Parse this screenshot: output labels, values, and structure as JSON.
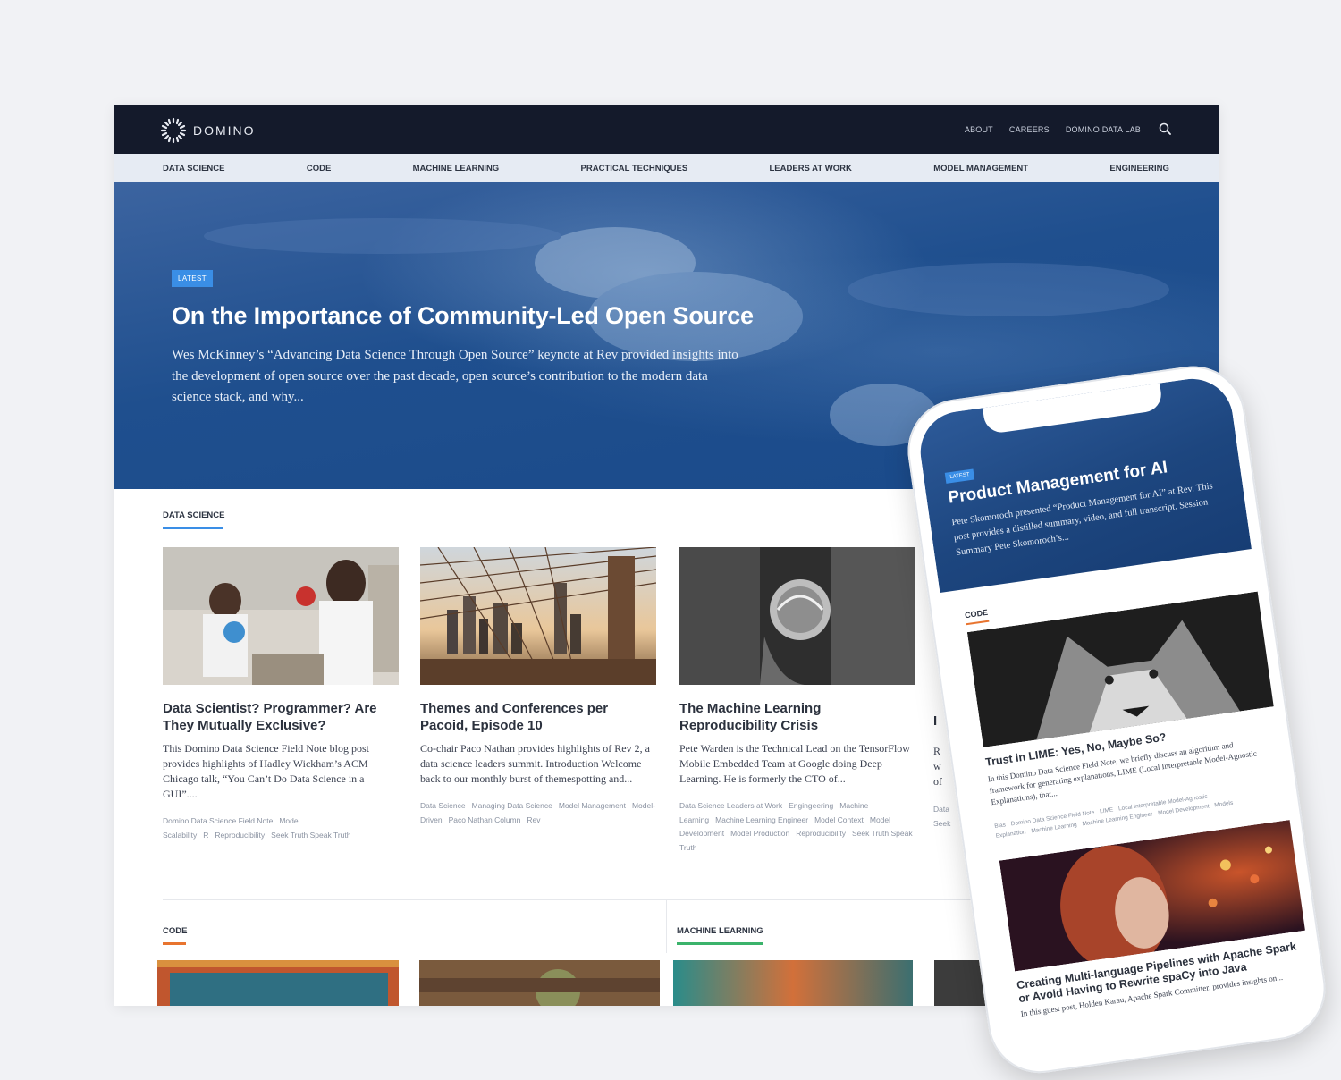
{
  "header": {
    "logo_text": "DOMINO",
    "nav": [
      "ABOUT",
      "CAREERS",
      "DOMINO DATA LAB"
    ]
  },
  "categories": [
    "DATA SCIENCE",
    "CODE",
    "MACHINE LEARNING",
    "PRACTICAL TECHNIQUES",
    "LEADERS AT WORK",
    "MODEL MANAGEMENT",
    "ENGINEERING"
  ],
  "hero": {
    "badge": "LATEST",
    "title": "On the Importance of Community-Led Open Source",
    "description": "Wes McKinney’s “Advancing Data Science Through Open Source” keynote at Rev provided insights into the development of open source over the past decade, open source’s contribution to the modern data science stack, and why..."
  },
  "sections": {
    "data_science_label": "DATA SCIENCE",
    "code_label": "CODE",
    "ml_label": "MACHINE LEARNING"
  },
  "cards": [
    {
      "title": "Data Scientist? Programmer? Are They Mutually Exclusive?",
      "excerpt": "This Domino Data Science Field Note blog post provides highlights of Hadley Wickham’s ACM Chicago talk, “You Can’t Do Data Science in a GUI”....",
      "tags": [
        "Domino Data Science Field Note",
        "Model Scalability",
        "R",
        "Reproducibility",
        "Seek Truth Speak Truth"
      ]
    },
    {
      "title": "Themes and Conferences per Pacoid, Episode 10",
      "excerpt": "Co-chair Paco Nathan provides highlights of Rev 2, a data science leaders summit. Introduction Welcome back to our monthly burst of themespotting and...",
      "tags": [
        "Data Science",
        "Managing Data Science",
        "Model Management",
        "Model-Driven",
        "Paco Nathan Column",
        "Rev"
      ]
    },
    {
      "title": "The Machine Learning Reproducibility Crisis",
      "excerpt": "Pete Warden is the Technical Lead on the TensorFlow Mobile Embedded Team at Google doing Deep Learning. He is formerly the CTO of...",
      "tags": [
        "Data Science Leaders at Work",
        "Engingeering",
        "Machine Learning",
        "Machine Learning Engineer",
        "Model Context",
        "Model Development",
        "Model Production",
        "Reproducibility",
        "Seek Truth Speak Truth"
      ]
    }
  ],
  "partial_card": {
    "title_char": "I",
    "excerpt_chars": [
      "R",
      "w",
      "of"
    ],
    "tags": [
      "Data",
      "Seek"
    ]
  },
  "phone": {
    "hero": {
      "badge": "LATEST",
      "title": "Product Management for AI",
      "description": "Pete Skomoroch presented “Product Management for AI” at Rev. This post provides a distilled summary, video, and full transcript. Session Summary Pete Skomoroch’s..."
    },
    "section_label": "CODE",
    "card1": {
      "title": "Trust in LIME: Yes, No, Maybe So?",
      "excerpt": "In this Domino Data Science Field Note, we briefly discuss an algorithm and framework for generating explanations, LIME (Local Interpretable Model-Agnostic Explanations), that...",
      "tags": [
        "Bias",
        "Domino Data Science Field Note",
        "LIME",
        "Local Interpretable Model-Agnostic Explanation",
        "Machine Learning",
        "Machine Learning Engineer",
        "Model Development",
        "Models"
      ]
    },
    "card2": {
      "title": "Creating Multi-language Pipelines with Apache Spark or Avoid Having to Rewrite spaCy into Java",
      "excerpt": "In this guest post, Holden Karau, Apache Spark Committer, provides insights on..."
    }
  },
  "colors": {
    "topbar": "#141a2b",
    "catnav": "#e6ebf3",
    "hero_blue": "#1f4f8e",
    "accent_blue": "#3a8ee6",
    "code_orange": "#e8742f",
    "ml_green": "#3bb36b"
  },
  "icons": [
    "domino-logo-icon",
    "search-icon"
  ]
}
